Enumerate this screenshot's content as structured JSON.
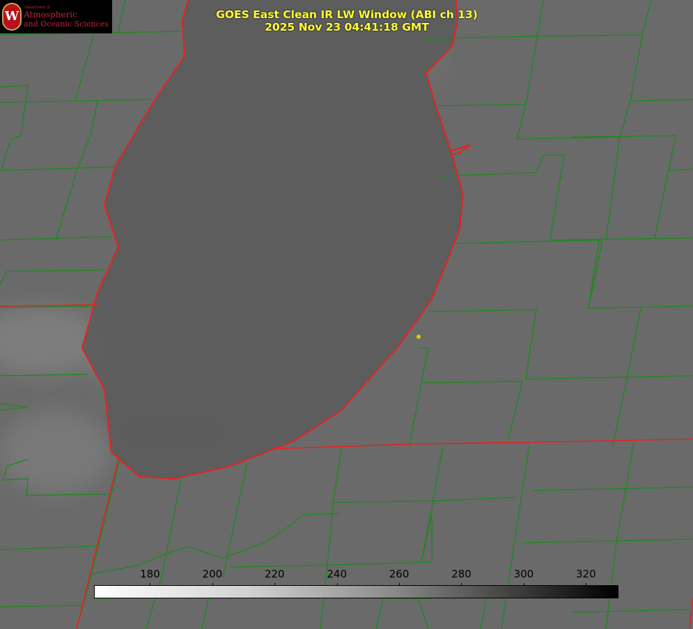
{
  "title": {
    "line1": "GOES East Clean IR LW Window (ABI ch 13)",
    "line2": "2025 Nov 23 04:41:18 GMT"
  },
  "logo": {
    "department": "Department of",
    "line1": "Atmospheric",
    "line2": "and Oceanic Sciences",
    "emblem": "W"
  },
  "colorbar": {
    "min": 162,
    "max": 330,
    "ticks": [
      "180",
      "200",
      "220",
      "240",
      "260",
      "280",
      "300",
      "320"
    ],
    "colors": [
      "#ffffff",
      "#000000"
    ]
  },
  "colors": {
    "county_lines": "#1a8a1a",
    "state_lines": "#e82020",
    "title": "#ffff33",
    "marker": "#d4d400"
  }
}
